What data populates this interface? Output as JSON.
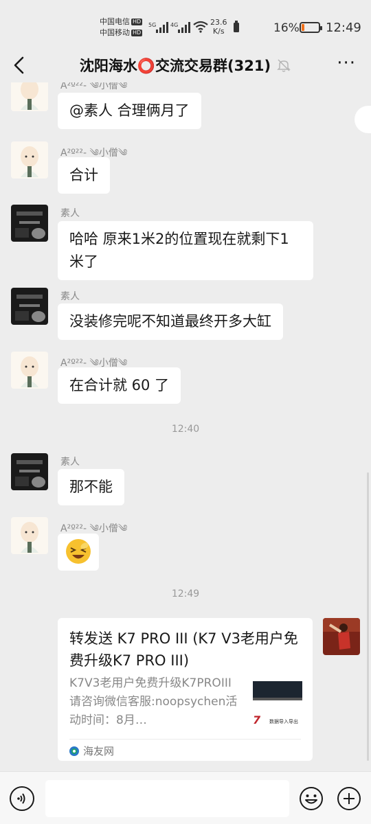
{
  "status_bar": {
    "carrier1": "中国电信",
    "carrier2": "中国移动",
    "hd": "HD",
    "sig1_label": "5G",
    "sig2_label": "4G",
    "net_speed_value": "23.6",
    "net_speed_unit": "K/s",
    "battery_pct": "16%",
    "battery_level": 0.16,
    "time": "12:49"
  },
  "header": {
    "title": "沈阳海水⭕交流交易群(321)",
    "more": "···"
  },
  "messages": [
    {
      "sender": "A²º²²- ༄小僧༄",
      "text": "@素人  合理俩月了"
    },
    {
      "sender": "A²º²²- ༄小僧༄",
      "text": "合计"
    },
    {
      "sender": "素人",
      "text": "哈哈 原来1米2的位置现在就剩下1米了"
    },
    {
      "sender": "素人",
      "text": "没装修完呢不知道最终开多大缸"
    },
    {
      "sender": "A²º²²- ༄小僧༄",
      "text": "在合计就 60 了"
    },
    {
      "sender": "素人",
      "text": "那不能"
    },
    {
      "sender": "A²º²²- ༄小僧༄",
      "text": "😆"
    }
  ],
  "time_separators": [
    "12:40",
    "12:49"
  ],
  "link_card": {
    "title": "转发送 K7 PRO III (K7 V3老用户免费升级K7 PRO III)",
    "description": "K7V3老用户免费升级K7PROIII请咨询微信客服:noopsychen活动时间：8月…",
    "thumb_brand": "7",
    "thumb_caption": "数据导入导出",
    "source": "海友网"
  },
  "input_bar": {
    "placeholder": ""
  }
}
